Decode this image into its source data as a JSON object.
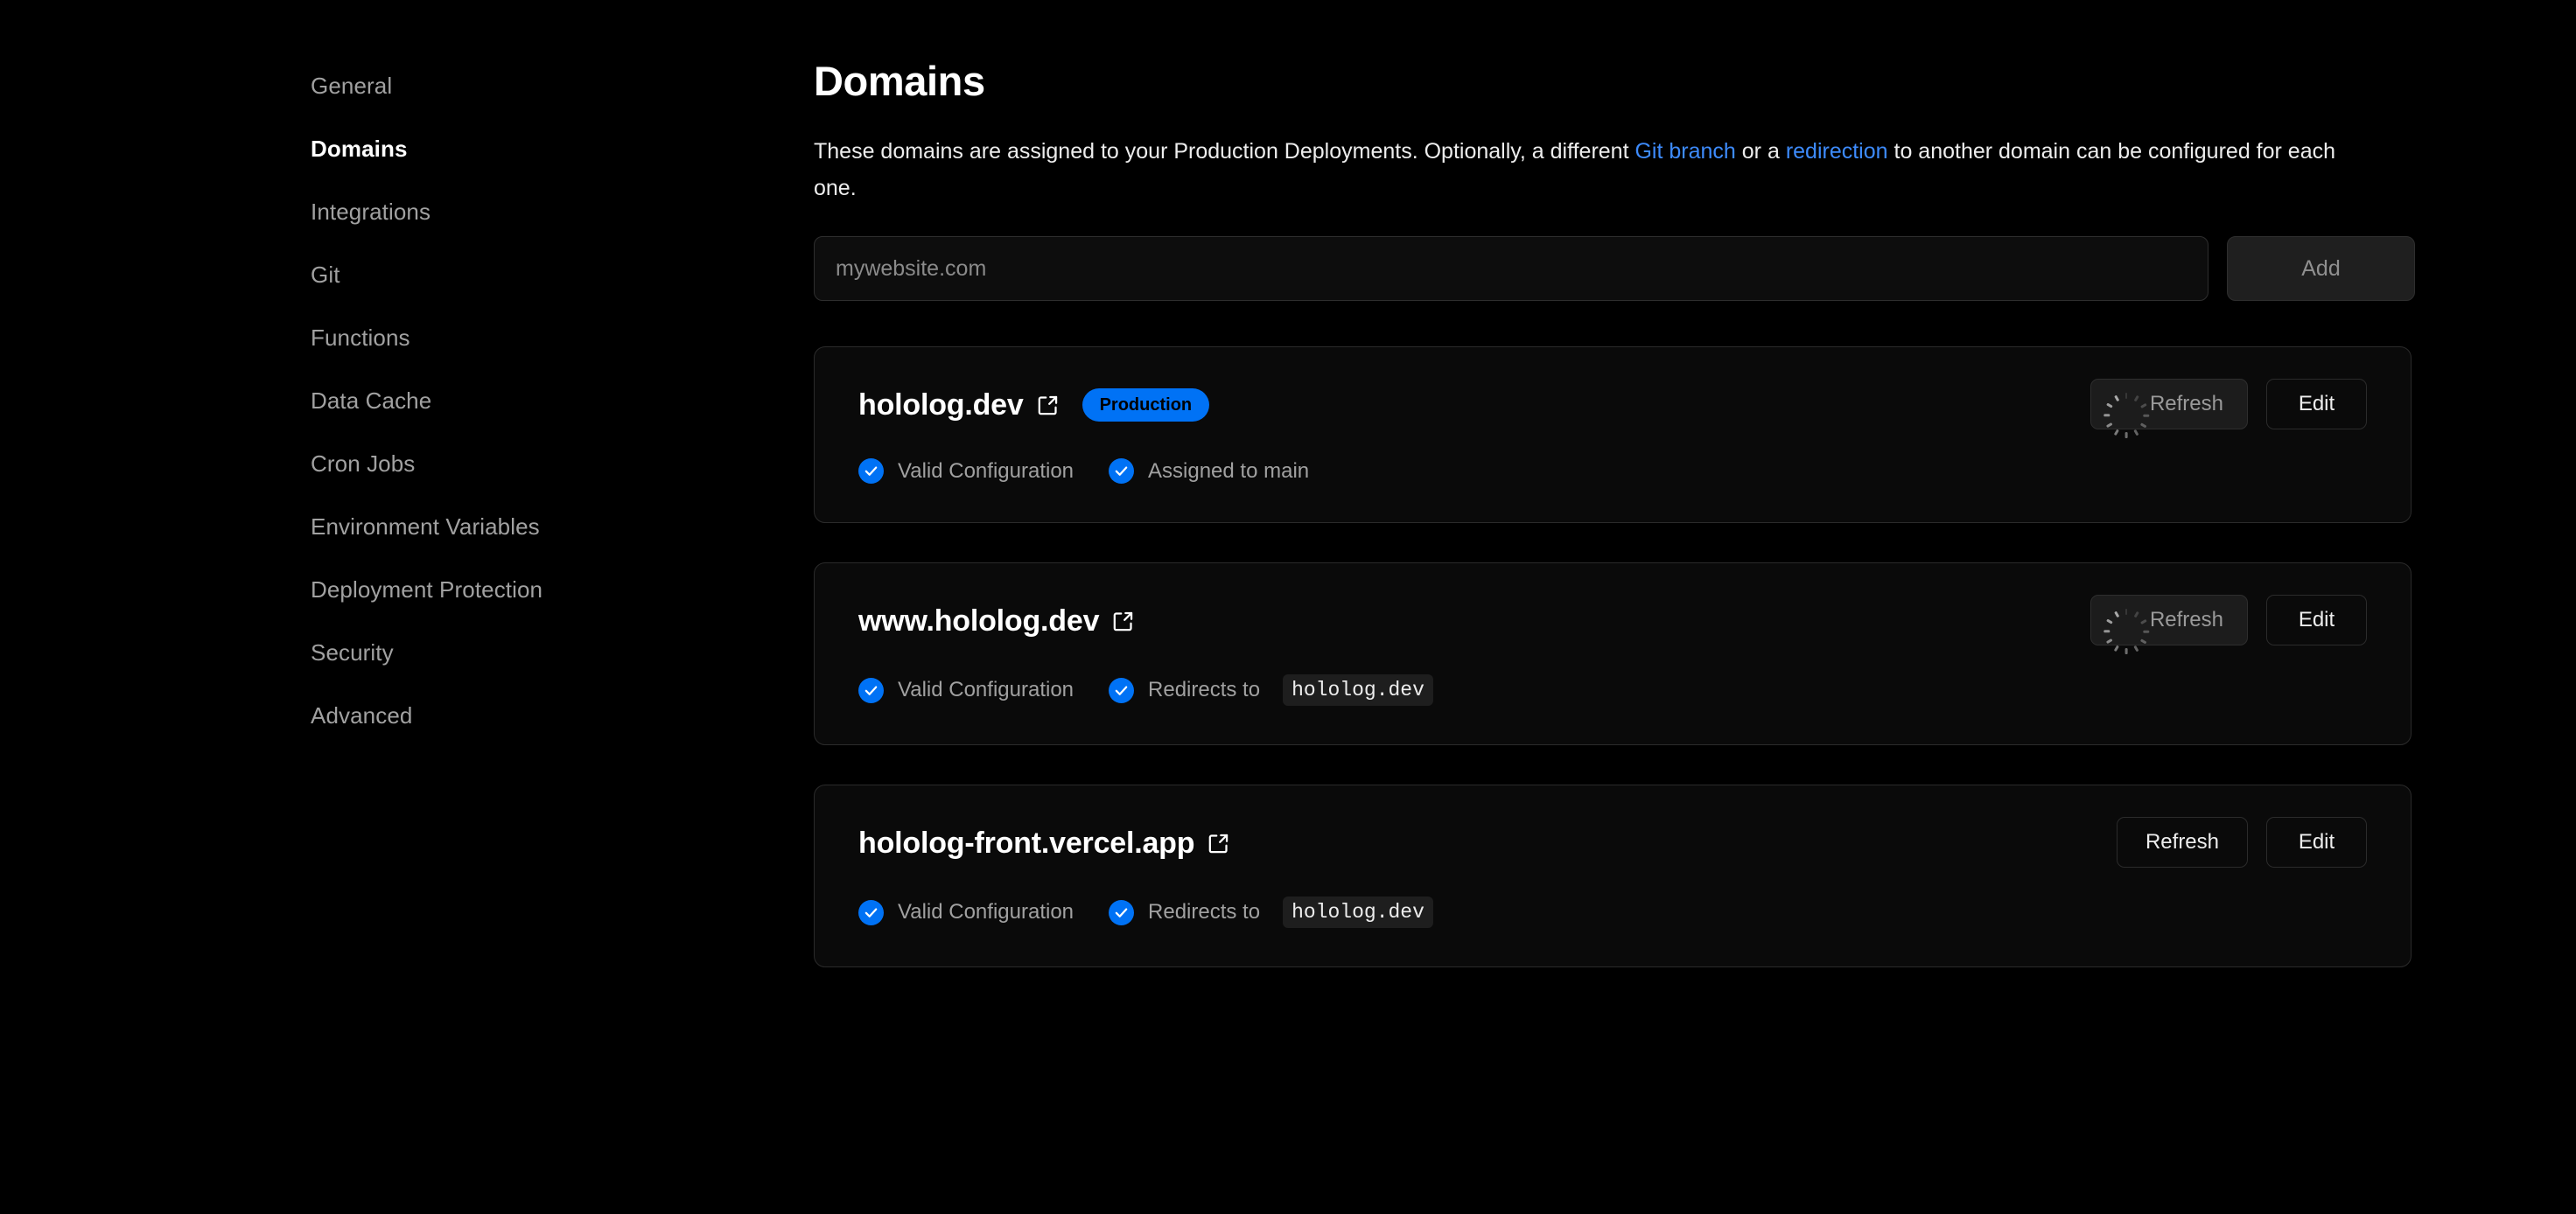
{
  "sidebar": {
    "items": [
      {
        "label": "General",
        "active": false
      },
      {
        "label": "Domains",
        "active": true
      },
      {
        "label": "Integrations",
        "active": false
      },
      {
        "label": "Git",
        "active": false
      },
      {
        "label": "Functions",
        "active": false
      },
      {
        "label": "Data Cache",
        "active": false
      },
      {
        "label": "Cron Jobs",
        "active": false
      },
      {
        "label": "Environment Variables",
        "active": false
      },
      {
        "label": "Deployment Protection",
        "active": false
      },
      {
        "label": "Security",
        "active": false
      },
      {
        "label": "Advanced",
        "active": false
      }
    ]
  },
  "main": {
    "title": "Domains",
    "description": {
      "part1": "These domains are assigned to your Production Deployments. Optionally, a different ",
      "link1": "Git branch",
      "part2": " or a ",
      "link2": "redirection",
      "part3": " to another domain can be configured for each one."
    },
    "add_form": {
      "input_placeholder": "mywebsite.com",
      "input_value": "",
      "add_label": "Add"
    },
    "cards": [
      {
        "domain": "hololog.dev",
        "external_icon": "external-link-icon",
        "badge": "Production",
        "refresh_label": "Refresh",
        "refresh_loading": true,
        "edit_label": "Edit",
        "statuses": [
          {
            "icon": "check-circle-icon",
            "text": "Valid Configuration",
            "code": ""
          },
          {
            "icon": "check-circle-icon",
            "text": "Assigned to main",
            "code": ""
          }
        ]
      },
      {
        "domain": "www.hololog.dev",
        "external_icon": "external-link-icon",
        "badge": "",
        "refresh_label": "Refresh",
        "refresh_loading": true,
        "edit_label": "Edit",
        "statuses": [
          {
            "icon": "check-circle-icon",
            "text": "Valid Configuration",
            "code": ""
          },
          {
            "icon": "check-circle-icon",
            "text": "Redirects to",
            "code": "hololog.dev"
          }
        ]
      },
      {
        "domain": "hololog-front.vercel.app",
        "external_icon": "external-link-icon",
        "badge": "",
        "refresh_label": "Refresh",
        "refresh_loading": false,
        "edit_label": "Edit",
        "statuses": [
          {
            "icon": "check-circle-icon",
            "text": "Valid Configuration",
            "code": ""
          },
          {
            "icon": "check-circle-icon",
            "text": "Redirects to",
            "code": "hololog.dev"
          }
        ]
      }
    ]
  },
  "colors": {
    "background": "#000000",
    "accent_blue": "#0072f5",
    "link_blue": "#3d8bfd",
    "card_bg": "#0a0a0a",
    "card_border": "#2b2b2b",
    "muted_text": "#a1a1a1",
    "code_chip_bg": "#1e1e1e"
  }
}
